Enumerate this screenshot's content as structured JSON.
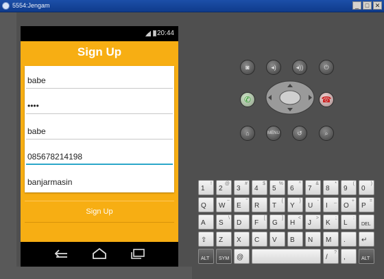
{
  "window": {
    "title": "5554:Jengam",
    "controls": [
      "_",
      "□",
      "✕"
    ]
  },
  "status_bar": {
    "time": "20:44"
  },
  "app": {
    "title": "Sign Up",
    "fields": [
      {
        "name": "username",
        "value": "babe"
      },
      {
        "name": "password",
        "value": "••••"
      },
      {
        "name": "name",
        "value": "babe"
      },
      {
        "name": "phone",
        "value": "085678214198",
        "focused": true
      },
      {
        "name": "city",
        "value": "banjarmasin"
      }
    ],
    "button_label": "Sign Up",
    "accent_color": "#f7ae13"
  },
  "nav_bar": {
    "icons": [
      "back-icon",
      "home-icon",
      "recents-icon"
    ]
  },
  "emulator_controls": {
    "top_row": [
      "camera-icon",
      "volume-down-icon",
      "volume-up-icon",
      "power-icon"
    ],
    "call_row": [
      "call-icon",
      "end-call-icon"
    ],
    "bottom_row": [
      "home-icon",
      "menu-icon",
      "back-icon",
      "search-icon"
    ]
  },
  "keyboard": {
    "row1": [
      {
        "main": "1",
        "alt": "!"
      },
      {
        "main": "2",
        "alt": "@"
      },
      {
        "main": "3",
        "alt": "#"
      },
      {
        "main": "4",
        "alt": "$"
      },
      {
        "main": "5",
        "alt": "%"
      },
      {
        "main": "6",
        "alt": "^"
      },
      {
        "main": "7",
        "alt": "&"
      },
      {
        "main": "8",
        "alt": "*"
      },
      {
        "main": "9",
        "alt": "("
      },
      {
        "main": "0",
        "alt": ")"
      }
    ],
    "row2": [
      {
        "main": "Q",
        "alt": ""
      },
      {
        "main": "W",
        "alt": "~"
      },
      {
        "main": "E",
        "alt": "\""
      },
      {
        "main": "R",
        "alt": ""
      },
      {
        "main": "T",
        "alt": "{"
      },
      {
        "main": "Y",
        "alt": "}"
      },
      {
        "main": "U",
        "alt": "-"
      },
      {
        "main": "I",
        "alt": "_"
      },
      {
        "main": "O",
        "alt": "+"
      },
      {
        "main": "P",
        "alt": "="
      }
    ],
    "row3": [
      {
        "main": "A",
        "alt": ""
      },
      {
        "main": "S",
        "alt": "\\"
      },
      {
        "main": "D",
        "alt": ""
      },
      {
        "main": "F",
        "alt": "["
      },
      {
        "main": "G",
        "alt": "]"
      },
      {
        "main": "H",
        "alt": "<"
      },
      {
        "main": "J",
        "alt": ">"
      },
      {
        "main": "K",
        "alt": ";"
      },
      {
        "main": "L",
        "alt": ":"
      },
      {
        "main": "DEL",
        "alt": ""
      }
    ],
    "row4": [
      {
        "main": "⇧",
        "alt": ""
      },
      {
        "main": "Z",
        "alt": ""
      },
      {
        "main": "X",
        "alt": ""
      },
      {
        "main": "C",
        "alt": ""
      },
      {
        "main": "V",
        "alt": ""
      },
      {
        "main": "B",
        "alt": ""
      },
      {
        "main": "N",
        "alt": ""
      },
      {
        "main": "M",
        "alt": ""
      },
      {
        "main": ".",
        "alt": ""
      },
      {
        "main": "↵",
        "alt": ""
      }
    ],
    "row5": [
      {
        "main": "ALT",
        "alt": ""
      },
      {
        "main": "SYM",
        "alt": ""
      },
      {
        "main": "@",
        "alt": ""
      },
      {
        "main": "",
        "alt": ""
      },
      {
        "main": "/",
        "alt": "?"
      },
      {
        "main": ",",
        "alt": ""
      },
      {
        "main": "ALT",
        "alt": ""
      }
    ]
  }
}
